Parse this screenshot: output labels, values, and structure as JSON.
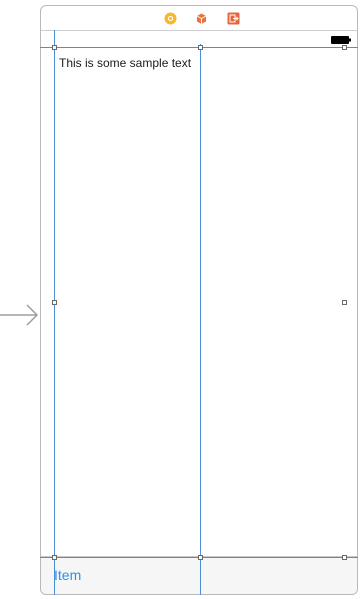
{
  "canvas": {
    "sample_label": "This is some sample text",
    "tab_bar": {
      "item_label": "Item",
      "item_color": "#2f8ef0"
    }
  },
  "scene_dock": {
    "icons": [
      "view-controller-icon",
      "first-responder-icon",
      "exit-icon"
    ]
  },
  "colors": {
    "guide_lines": "#4a90d9",
    "scene_border": "#b9b9b9",
    "tab_bar_background": "#f6f6f7"
  }
}
